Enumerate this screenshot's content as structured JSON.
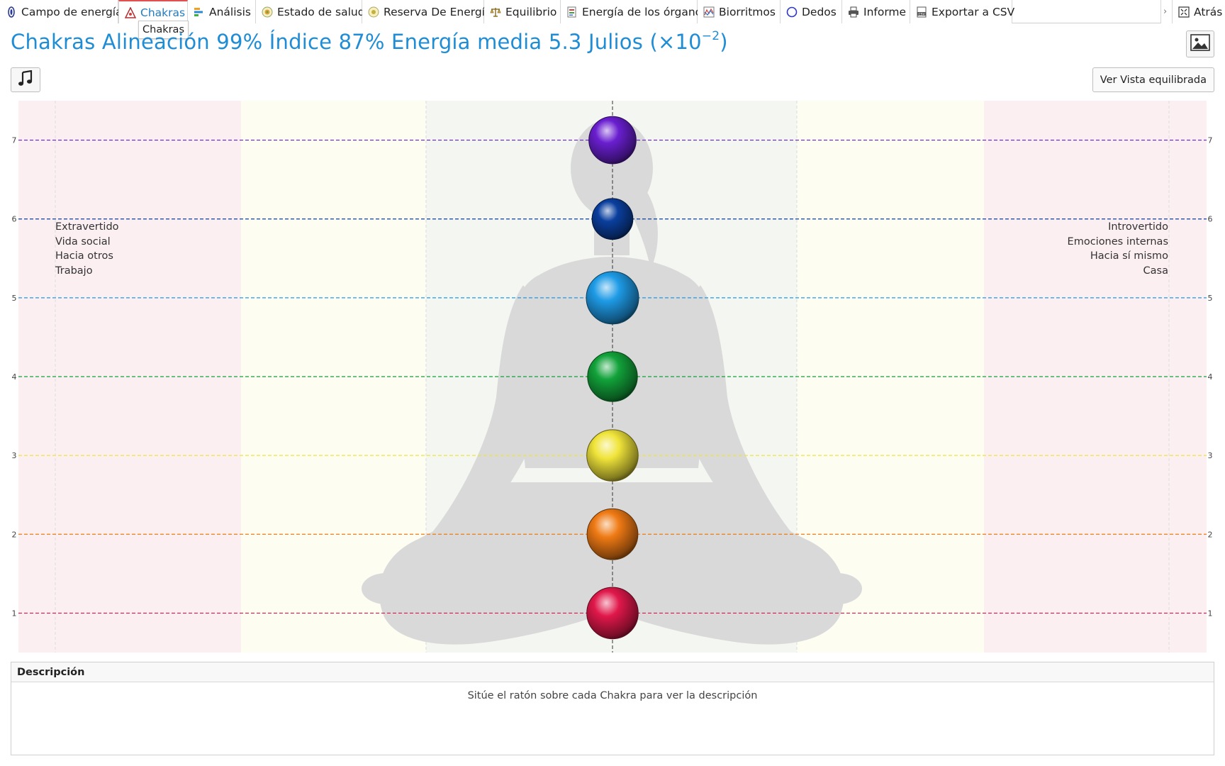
{
  "tabs": [
    {
      "label": "Campo de energía",
      "icon": "aura-icon"
    },
    {
      "label": "Chakras",
      "icon": "chakra-triangle-icon"
    },
    {
      "label": "Análisis",
      "icon": "bar-chart-icon"
    },
    {
      "label": "Estado de salud",
      "icon": "health-target-icon"
    },
    {
      "label": "Reserva De Energía",
      "icon": "energy-reserve-icon"
    },
    {
      "label": "Equilibrio",
      "icon": "scales-icon"
    },
    {
      "label": "Energía de los órganos",
      "icon": "organs-document-icon"
    },
    {
      "label": "Biorritmos",
      "icon": "biorhythm-chart-icon"
    },
    {
      "label": "Dedos",
      "icon": "finger-circle-icon"
    },
    {
      "label": "Informe",
      "icon": "printer-icon"
    },
    {
      "label": "Exportar a CSV",
      "icon": "csv-file-icon"
    }
  ],
  "active_tab": "Chakras",
  "tooltip": "Chakras",
  "back_label": "Atrás",
  "title": {
    "prefix": "Chakras Alineación 99% Índice 87% Energía media 5.3 Julios (×10",
    "exponent": "−2",
    "suffix": ")"
  },
  "view_button_label": "Ver Vista equilibrada",
  "left_labels": [
    "Extravertido",
    "Vida social",
    "Hacia otros",
    "Trabajo"
  ],
  "right_labels": [
    "Introvertido",
    "Emociones internas",
    "Hacia sí mismo",
    "Casa"
  ],
  "description": {
    "header": "Descripción",
    "text": "Sitúe el ratón sobre cada Chakra para ver la descripción"
  },
  "chart_data": {
    "type": "scatter",
    "y_ticks": [
      1,
      2,
      3,
      4,
      5,
      6,
      7
    ],
    "ylim": [
      0.5,
      7.5
    ],
    "chakras": [
      {
        "level": 7,
        "color": "#6a1fd0",
        "size": 0.9
      },
      {
        "level": 6,
        "color": "#0a3f9e",
        "size": 0.78
      },
      {
        "level": 5,
        "color": "#1e9be6",
        "size": 1.0
      },
      {
        "level": 4,
        "color": "#12a23a",
        "size": 0.95
      },
      {
        "level": 3,
        "color": "#f0e43a",
        "size": 0.98
      },
      {
        "level": 2,
        "color": "#ef7a14",
        "size": 0.97
      },
      {
        "level": 1,
        "color": "#e0184a",
        "size": 0.98
      }
    ],
    "bands": [
      {
        "color": "#fbeff2"
      },
      {
        "color": "#fdfdf2"
      },
      {
        "color": "#f4f6f1"
      },
      {
        "color": "#fdfdf2"
      },
      {
        "color": "#fbeff2"
      }
    ]
  }
}
